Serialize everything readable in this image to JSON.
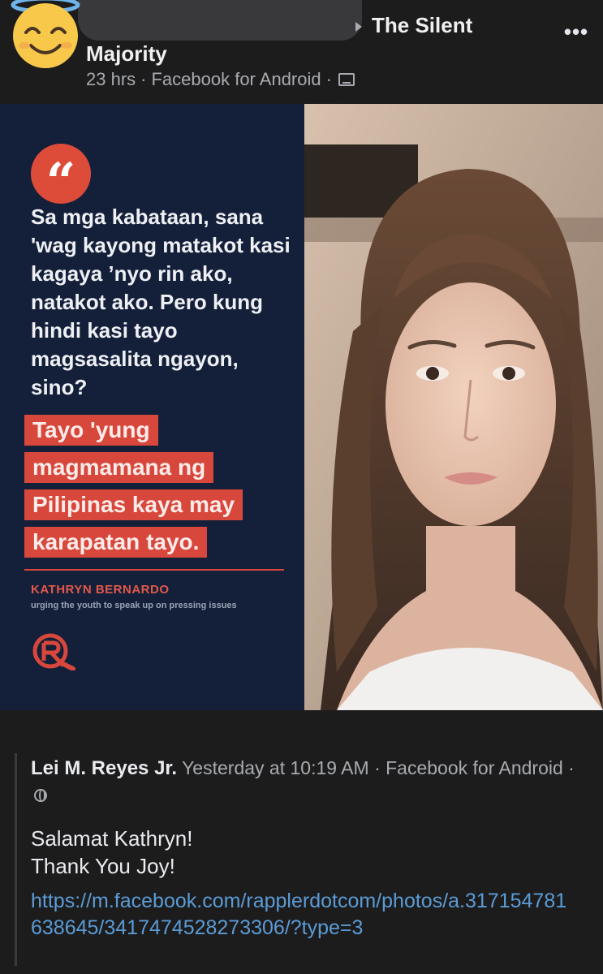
{
  "post": {
    "name_line1": "The Silent",
    "name_line2": "Majority",
    "time": "23 hrs",
    "separator": "·",
    "source": "Facebook for Android",
    "audience_icon": "friends-icon",
    "more_icon": "more-options-icon"
  },
  "shared_image": {
    "quote_mark": "“",
    "quote_text": "Sa mga kabataan, sana 'wag kayong matakot kasi kagaya ’nyo rin ako, natakot ako. Pero kung hindi kasi tayo magsasalita ngayon, sino?",
    "highlight_lines": [
      "Tayo 'yung",
      "magmamana ng",
      "Pilipinas kaya may",
      "karapatan tayo."
    ],
    "author": "KATHRYN BERNARDO",
    "author_desc": "urging the youth to speak up on pressing issues",
    "accent": "#d8473b",
    "panel_bg": "#14203a"
  },
  "original_post": {
    "author": "Lei M. Reyes Jr.",
    "timestamp": "Yesterday at 10:19 AM",
    "source": "Facebook for Android",
    "separator": "·",
    "audience_icon": "globe-icon",
    "message_line1": "Salamat Kathryn!",
    "message_line2": "Thank You Joy!",
    "link": "https://m.facebook.com/rapplerdotcom/photos/a.317154781638645/3417474528273306/?type=3",
    "link_color": "#5b9bd5"
  }
}
